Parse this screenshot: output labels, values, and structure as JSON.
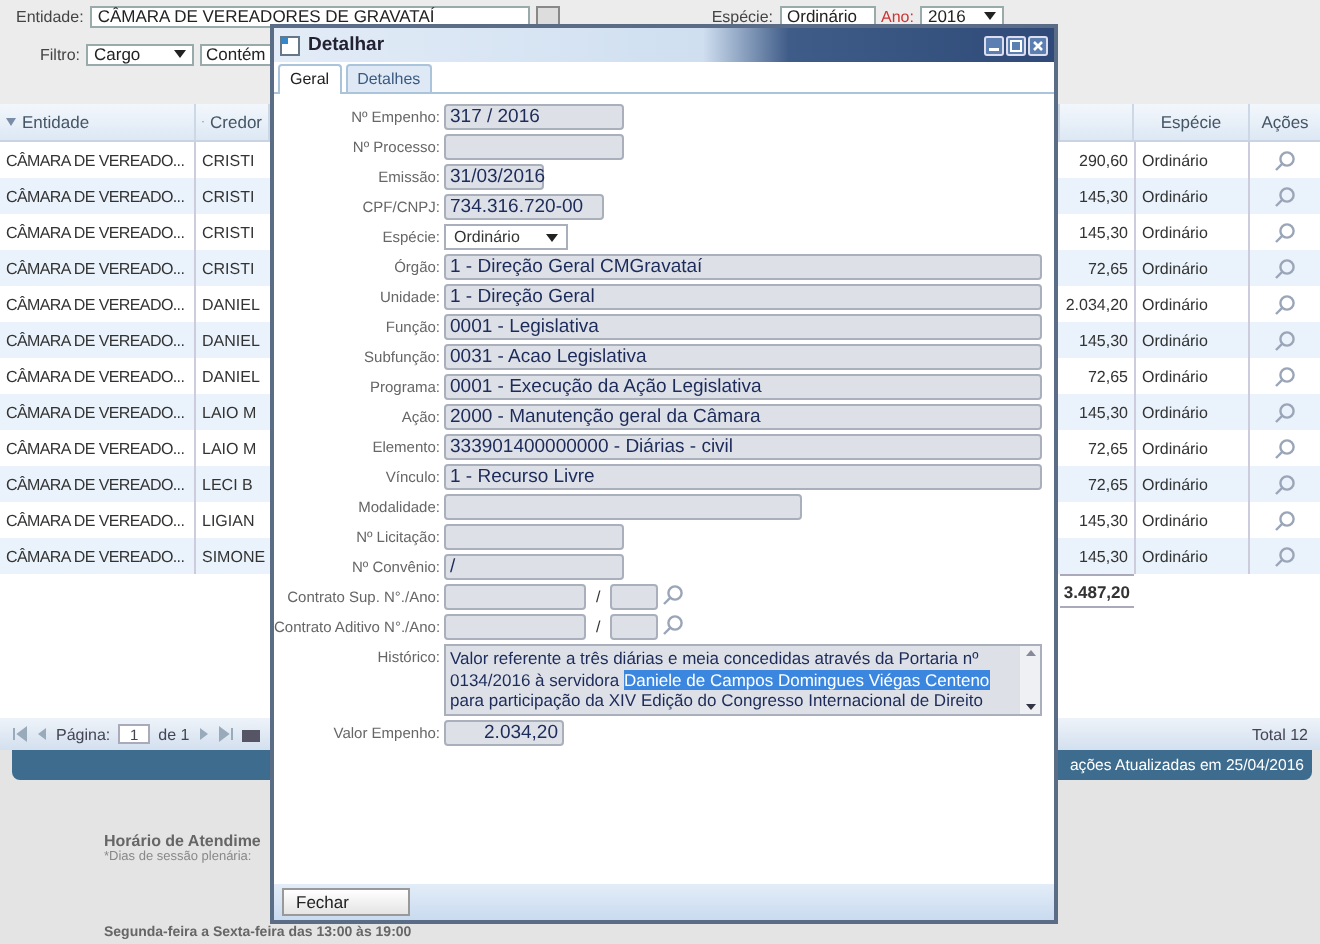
{
  "filters": {
    "entidade_label": "Entidade:",
    "entidade": "CÂMARA DE VEREADORES DE GRAVATAÍ",
    "especie_label": "Espécie:",
    "especie": "Ordinário",
    "ano_label": "Ano:",
    "ano": "2016",
    "filtro_label": "Filtro:",
    "filtro_campo": "Cargo",
    "filtro_operador": "Contém"
  },
  "table": {
    "columns": {
      "entidade": "Entidade",
      "credor": "Credor",
      "especie": "Espécie",
      "acoes": "Ações"
    },
    "rows": [
      {
        "entidade": "CÂMARA DE VEREADO...",
        "credor": "CRISTI",
        "valor": "290,60",
        "especie": "Ordinário"
      },
      {
        "entidade": "CÂMARA DE VEREADO...",
        "credor": "CRISTI",
        "valor": "145,30",
        "especie": "Ordinário"
      },
      {
        "entidade": "CÂMARA DE VEREADO...",
        "credor": "CRISTI",
        "valor": "145,30",
        "especie": "Ordinário"
      },
      {
        "entidade": "CÂMARA DE VEREADO...",
        "credor": "CRISTI",
        "valor": "72,65",
        "especie": "Ordinário"
      },
      {
        "entidade": "CÂMARA DE VEREADO...",
        "credor": "DANIEL",
        "valor": "2.034,20",
        "especie": "Ordinário"
      },
      {
        "entidade": "CÂMARA DE VEREADO...",
        "credor": "DANIEL",
        "valor": "145,30",
        "especie": "Ordinário"
      },
      {
        "entidade": "CÂMARA DE VEREADO...",
        "credor": "DANIEL",
        "valor": "72,65",
        "especie": "Ordinário"
      },
      {
        "entidade": "CÂMARA DE VEREADO...",
        "credor": "LAIO M",
        "valor": "145,30",
        "especie": "Ordinário"
      },
      {
        "entidade": "CÂMARA DE VEREADO...",
        "credor": "LAIO M",
        "valor": "72,65",
        "especie": "Ordinário"
      },
      {
        "entidade": "CÂMARA DE VEREADO...",
        "credor": "LECI B",
        "valor": "72,65",
        "especie": "Ordinário"
      },
      {
        "entidade": "CÂMARA DE VEREADO...",
        "credor": "LIGIAN",
        "valor": "145,30",
        "especie": "Ordinário"
      },
      {
        "entidade": "CÂMARA DE VEREADO...",
        "credor": "SIMONE",
        "valor": "145,30",
        "especie": "Ordinário"
      }
    ],
    "total": "3.487,20"
  },
  "pager": {
    "page_label": "Página:",
    "page": "1",
    "of": "de 1",
    "total": "Total 12"
  },
  "update_bar": "ações Atualizadas em 25/04/2016",
  "footer": {
    "title": "Horário de Atendime",
    "note": "*Dias de sessão plenária:",
    "hours": "Segunda-feira a Sexta-feira das 13:00 às 19:00"
  },
  "dialog": {
    "title": "Detalhar",
    "tabs": [
      {
        "label": "Geral",
        "selected": true
      },
      {
        "label": "Detalhes",
        "selected": false
      }
    ],
    "fields": [
      {
        "kind": "text",
        "label": "Nº Empenho:",
        "value": "317 / 2016"
      },
      {
        "kind": "text",
        "label": "Nº Processo:"
      },
      {
        "kind": "text",
        "label": "Emissão:",
        "value": "31/03/2016"
      },
      {
        "kind": "text",
        "label": "CPF/CNPJ:",
        "value": "734.316.720-00"
      },
      {
        "kind": "select",
        "label": "Espécie:",
        "value": "Ordinário"
      },
      {
        "kind": "text",
        "label": "Órgão:",
        "value": "1 - Direção Geral CMGravataí"
      },
      {
        "kind": "text",
        "label": "Unidade:",
        "value": "1 - Direção Geral"
      },
      {
        "kind": "text",
        "label": "Função:",
        "value": "0001 - Legislativa"
      },
      {
        "kind": "text",
        "label": "Subfunção:",
        "value": "0031 - Acao Legislativa"
      },
      {
        "kind": "text",
        "label": "Programa:",
        "value": "0001 - Execução da Ação Legislativa"
      },
      {
        "kind": "text",
        "label": "Ação:",
        "value": "2000 - Manutenção geral da Câmara"
      },
      {
        "kind": "text",
        "label": "Elemento:",
        "value": "333901400000000 - Diárias - civil"
      },
      {
        "kind": "text",
        "label": "Vínculo:",
        "value": "1 -  Recurso Livre"
      },
      {
        "kind": "text",
        "label": "Modalidade:"
      },
      {
        "kind": "text",
        "label": "Nº Licitação:"
      },
      {
        "kind": "text",
        "label": "Nº Convênio:",
        "value": "/"
      },
      {
        "kind": "contract",
        "label": "Contrato Sup. N°./Ano:",
        "separator": "/"
      },
      {
        "kind": "contract",
        "label": "Contrato Aditivo N°./Ano:",
        "separator": "/"
      },
      {
        "kind": "textarea",
        "label": "Histórico:",
        "parts": [
          {
            "text": "Valor referente a três diárias e meia concedidas através da Portaria nº 0134/2016 à servidora ",
            "selected": false
          },
          {
            "text": "Daniele de Campos Domingues Viégas Centeno",
            "selected": true
          },
          {
            "text": " para participação da XIV Edição do Congresso Internacional de Direito",
            "selected": false
          }
        ]
      },
      {
        "kind": "number",
        "label": "Valor Empenho:",
        "value": "2.034,20"
      }
    ],
    "close_button": "Fechar"
  }
}
